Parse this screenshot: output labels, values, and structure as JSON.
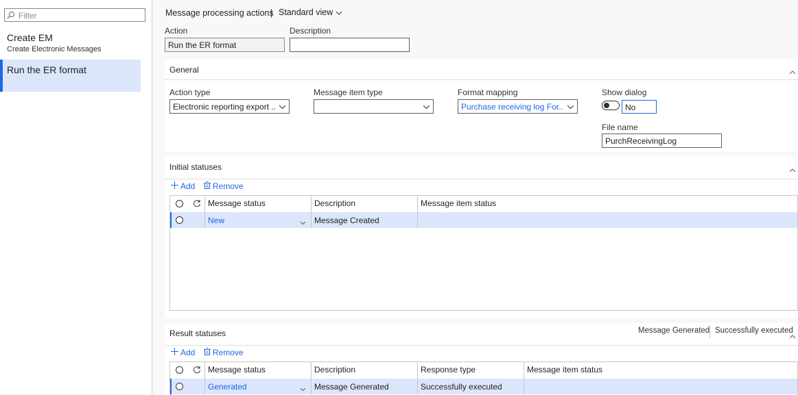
{
  "sidebar": {
    "filter_placeholder": "Filter",
    "items": [
      {
        "title": "Create EM",
        "subtitle": "Create Electronic Messages"
      },
      {
        "title": "Run the ER format",
        "subtitle": ""
      }
    ]
  },
  "header": {
    "title": "Message processing actions",
    "separator": "|",
    "view_label": "Standard view"
  },
  "action_field": {
    "label": "Action",
    "value": "Run the ER format"
  },
  "description_field": {
    "label": "Description",
    "value": ""
  },
  "general": {
    "title": "General",
    "action_type": {
      "label": "Action type",
      "value": "Electronic reporting export ..."
    },
    "message_item_type": {
      "label": "Message item type",
      "value": ""
    },
    "format_mapping": {
      "label": "Format mapping",
      "value": "Purchase receiving log For..."
    },
    "show_dialog": {
      "label": "Show dialog",
      "value": "No"
    },
    "file_name": {
      "label": "File name",
      "value": "PurchReceivingLog"
    }
  },
  "initial_statuses": {
    "title": "Initial statuses",
    "add_label": "Add",
    "remove_label": "Remove",
    "columns": [
      "Message status",
      "Description",
      "Message item status"
    ],
    "rows": [
      {
        "message_status": "New",
        "description": "Message Created",
        "message_item_status": ""
      }
    ]
  },
  "result_statuses": {
    "title": "Result statuses",
    "summary": [
      "Message Generated",
      "Successfully executed"
    ],
    "add_label": "Add",
    "remove_label": "Remove",
    "columns": [
      "Message status",
      "Description",
      "Response type",
      "Message item status"
    ],
    "rows": [
      {
        "message_status": "Generated",
        "description": "Message Generated",
        "response_type": "Successfully executed",
        "message_item_status": ""
      }
    ]
  },
  "colors": {
    "accent": "#2266e3",
    "selected_bg": "#dce6fb"
  }
}
